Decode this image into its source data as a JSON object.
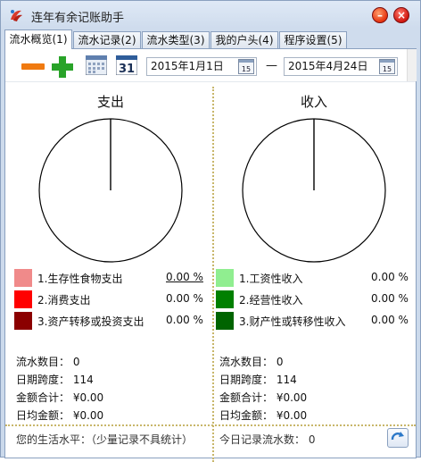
{
  "window": {
    "title": "连年有余记账助手"
  },
  "tabs": [
    {
      "label": "流水概览(1)"
    },
    {
      "label": "流水记录(2)"
    },
    {
      "label": "流水类型(3)"
    },
    {
      "label": "我的户头(4)"
    },
    {
      "label": "程序设置(5)"
    }
  ],
  "toolbar": {
    "icons": [
      "minus-icon",
      "plus-icon",
      "calendar-grid-icon",
      "calendar-31-icon"
    ],
    "date_from": "2015年1月1日",
    "date_to": "2015年4月24日",
    "date_separator": "—",
    "calendar_btn_label": "15"
  },
  "expense": {
    "title": "支出",
    "pie_color": "#ffffff",
    "legend": [
      {
        "label": "1.生存性食物支出",
        "pct": "0.00 %",
        "color": "#f08a8a"
      },
      {
        "label": "2.消费支出",
        "pct": "0.00 %",
        "color": "#ff0000"
      },
      {
        "label": "3.资产转移或投资支出",
        "pct": "0.00 %",
        "color": "#8b0000"
      }
    ],
    "stats": {
      "count": "流水数目： 0",
      "span": "日期跨度： 114",
      "total": "金额合计： ¥0.00",
      "daily": "日均金额： ¥0.00"
    }
  },
  "income": {
    "title": "收入",
    "pie_color": "#ffffff",
    "legend": [
      {
        "label": "1.工资性收入",
        "pct": "0.00 %",
        "color": "#90ee90"
      },
      {
        "label": "2.经营性收入",
        "pct": "0.00 %",
        "color": "#008000"
      },
      {
        "label": "3.财产性或转移性收入",
        "pct": "0.00 %",
        "color": "#006400"
      }
    ],
    "stats": {
      "count": "流水数目： 0",
      "span": "日期跨度： 114",
      "total": "金额合计： ¥0.00",
      "daily": "日均金额： ¥0.00"
    }
  },
  "footer": {
    "left_text": "您的生活水平：（少量记录不具统计）",
    "right_text": "今日记录流水数： 0"
  }
}
